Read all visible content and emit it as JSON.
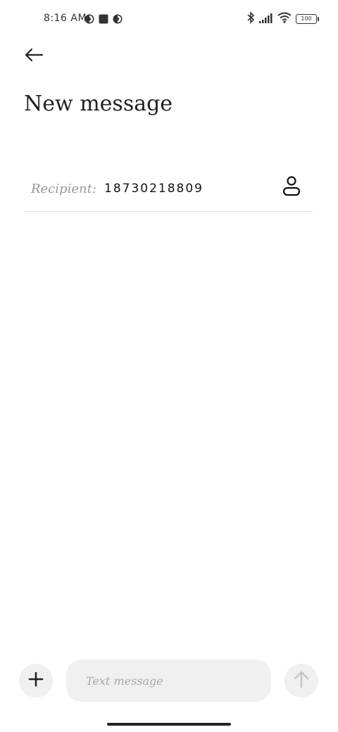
{
  "status_bar": {
    "time": "8:16 AM",
    "battery": "100"
  },
  "header": {
    "title": "New message"
  },
  "recipient": {
    "label": "Recipient:",
    "value": "18730218809"
  },
  "compose": {
    "placeholder": "Text message"
  },
  "icons": {
    "back": "arrow-left-icon",
    "contact": "person-icon",
    "attach": "plus-icon",
    "send": "arrow-up-icon"
  },
  "colors": {
    "background": "#ffffff",
    "input_bg": "#f0f0f0",
    "placeholder": "#a8a8a8",
    "label": "#999999",
    "send_disabled": "#c4c4c4"
  }
}
